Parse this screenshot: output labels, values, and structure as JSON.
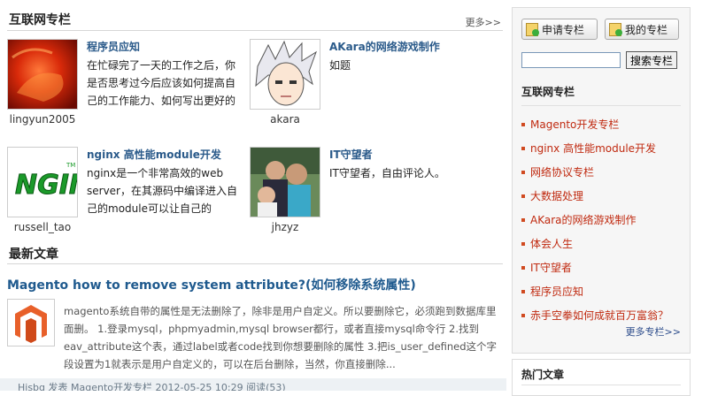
{
  "columns_section": {
    "title": "互联网专栏",
    "more": "更多>>",
    "cards": [
      {
        "name": "程序员应知",
        "desc": "在忙碌完了一天的工作之后，你是否思考过今后应该如何提高自己的工作能力、如何写出更好的",
        "author": "lingyun2005"
      },
      {
        "name": "AKara的网络游戏制作",
        "desc": "如题",
        "author": "akara"
      },
      {
        "name": "nginx 高性能module开发",
        "desc": "nginx是一个非常高效的web server，在其源码中编译进入自己的module可以让自己的",
        "author": "russell_tao"
      },
      {
        "name": "IT守望者",
        "desc": "IT守望者，自由评论人。",
        "author": "jhzyz"
      }
    ]
  },
  "latest_section": {
    "title": "最新文章",
    "article": {
      "title": "Magento how to remove system attribute?(如何移除系统属性)",
      "summary": "magento系统自带的属性是无法删除了，除非是用户自定义。所以要删除它，必须跑到数据库里面删。 1.登录mysql，phpmyadmin,mysql browser都行，或者直接mysql命令行 2.找到eav_attribute这个表，通过label或者code找到你想要删除的属性 3.把is_user_defined这个字段设置为1就表示是用户自定义的，可以在后台删除，当然，你直接删除...",
      "meta": "Hisbq  发表  Magento开发专栏  2012-05-25 10:29  阅读(53)"
    }
  },
  "sidebar": {
    "apply_button": "申请专栏",
    "my_button": "我的专栏",
    "search_value": "",
    "search_button": "搜索专栏",
    "list_title": "互联网专栏",
    "items": [
      "Magento开发专栏",
      "nginx 高性能module开发",
      "网络协议专栏",
      "大数据处理",
      "AKara的网络游戏制作",
      "体会人生",
      "IT守望者",
      "程序员应知",
      "赤手空拳如何成就百万富翁？"
    ],
    "more": "更多专栏>>",
    "hot_title": "热门文章"
  },
  "colors": {
    "link_blue": "#1f5a8e",
    "sidebar_red": "#c02a10"
  }
}
